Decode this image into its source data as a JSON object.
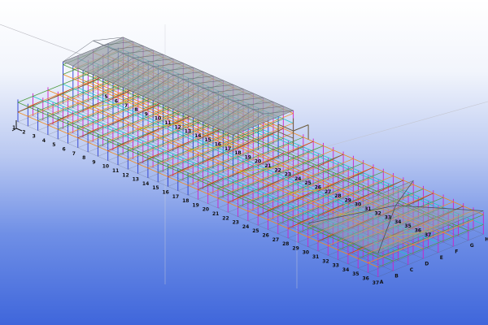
{
  "viewer": {
    "view_mode": "3d-isometric",
    "background_top": "#ffffff",
    "background_bottom": "#3f66db"
  },
  "model": {
    "member_colors": {
      "column": "#d020c8",
      "beam_x": "#20c8c8",
      "beam_y": "#f08a1c",
      "beam_z": "#4a9a3a",
      "brace": "#b82020",
      "blue_member": "#2a3ad0",
      "roof": "#9aa0a8",
      "deck": "#c8c020",
      "grid_line": "#4a4a4a"
    },
    "grid_labels": {
      "front_numbers": [
        "1",
        "2",
        "3",
        "4",
        "5",
        "6",
        "7",
        "8",
        "9",
        "10",
        "11",
        "12",
        "13",
        "14",
        "15",
        "16",
        "17",
        "18",
        "19",
        "20",
        "21",
        "22",
        "23",
        "24",
        "25",
        "26",
        "27",
        "28",
        "29",
        "30",
        "31",
        "32",
        "33",
        "34",
        "35",
        "36",
        "37"
      ],
      "mid_numbers": [
        "5",
        "6",
        "7",
        "8",
        "9",
        "10",
        "11",
        "12",
        "13",
        "14",
        "15",
        "16",
        "17",
        "18",
        "19",
        "20",
        "21",
        "22",
        "23",
        "24",
        "25",
        "26",
        "27",
        "28",
        "29",
        "30",
        "31",
        "32",
        "33",
        "34",
        "35",
        "36",
        "37"
      ],
      "end_letters": [
        "A",
        "B",
        "C",
        "D",
        "E",
        "F",
        "G",
        "H"
      ]
    }
  }
}
